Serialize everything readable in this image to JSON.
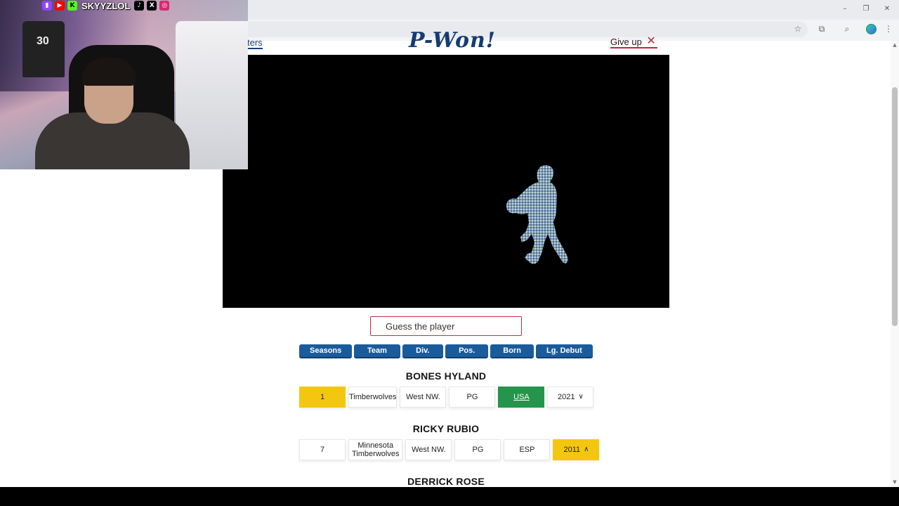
{
  "browser": {
    "window_controls": [
      "–",
      "❐",
      "✕"
    ],
    "toolbar_icons": [
      "☆",
      "⧉",
      "⌕",
      "⋮"
    ]
  },
  "header": {
    "nav_link": "ters",
    "logo": "P-Won!",
    "give_up": "Give up",
    "give_up_icon": "✕"
  },
  "search": {
    "placeholder": "Guess the player"
  },
  "columns": [
    "Seasons",
    "Team",
    "Div.",
    "Pos.",
    "Born",
    "Lg. Debut"
  ],
  "guesses": [
    {
      "name": "BONES HYLAND",
      "cells": [
        {
          "value": "1",
          "status": "yellow"
        },
        {
          "value": "Timberwolves",
          "status": "none"
        },
        {
          "value": "West NW.",
          "status": "none"
        },
        {
          "value": "PG",
          "status": "none"
        },
        {
          "value": "USA",
          "status": "green"
        },
        {
          "value": "2021",
          "status": "none",
          "arrow": "down"
        }
      ]
    },
    {
      "name": "RICKY RUBIO",
      "cells": [
        {
          "value": "7",
          "status": "none"
        },
        {
          "value": "Minnesota Timberwolves",
          "status": "none"
        },
        {
          "value": "West NW.",
          "status": "none"
        },
        {
          "value": "PG",
          "status": "none"
        },
        {
          "value": "ESP",
          "status": "none"
        },
        {
          "value": "2011",
          "status": "yellow",
          "arrow": "up"
        }
      ]
    },
    {
      "name": "DERRICK ROSE",
      "cells": []
    }
  ],
  "webcam": {
    "handle": "SKYYZLOL",
    "jersey_number": "30",
    "social_icons": [
      "twitch-icon",
      "youtube-icon",
      "kick-icon",
      "tiktok-icon",
      "x-icon",
      "instagram-icon"
    ],
    "social_glyphs": [
      "▮",
      "▶",
      "K",
      "♪",
      "X",
      "◎"
    ]
  },
  "colors": {
    "yellow": "#f3c70f",
    "green": "#24954a",
    "tab_blue": "#1a5b9c",
    "input_border": "#c92b3f"
  }
}
